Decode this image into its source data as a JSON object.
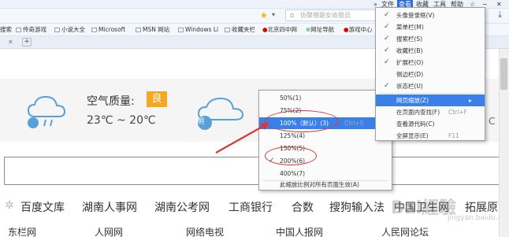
{
  "menubar": {
    "items": [
      "»",
      "文件",
      "查看",
      "收藏",
      "工具",
      "帮助"
    ],
    "active": "查看"
  },
  "addressbar": {
    "search_placeholder": "协警猥褻女收银员"
  },
  "favorites": [
    "搜索",
    "传奇游戏",
    "小说大全",
    "Microsoft",
    "MSN 网站",
    "Windows Li",
    "收藏夹栏",
    "北京四中网",
    "网址导航",
    "游戏中心"
  ],
  "weather": {
    "air_quality_label": "空气质量:",
    "air_quality_value": "良",
    "temperature": "23℃ ~ 20℃",
    "day2_label": "明",
    "day2_temp_partial": "C"
  },
  "links": [
    "百度文库",
    "湖南人事网",
    "湖南公考网",
    "工商银行",
    "合数",
    "搜狗输入法",
    "中国卫生网",
    "拓展原"
  ],
  "bottom_links": [
    "东栏网",
    "人网网",
    "网络电视",
    "中国人报网",
    "人民网论坛"
  ],
  "zoom_menu": {
    "items": [
      {
        "label": "50%(1)",
        "shortcut": "",
        "checked": false,
        "selected": false
      },
      {
        "label": "75%(2)",
        "shortcut": "",
        "checked": false,
        "selected": false
      },
      {
        "label": "100%（默认）(3)",
        "shortcut": "Ctrl+0",
        "checked": false,
        "selected": true
      },
      {
        "label": "125%(4)",
        "shortcut": "",
        "checked": false,
        "selected": false
      },
      {
        "label": "150%(5)",
        "shortcut": "",
        "checked": false,
        "selected": false
      },
      {
        "label": "200%(6)",
        "shortcut": "",
        "checked": true,
        "selected": false
      },
      {
        "label": "400%(7)",
        "shortcut": "",
        "checked": false,
        "selected": false
      }
    ],
    "footer": "此缩放比例对所有页面生效(A)"
  },
  "view_menu": {
    "items": [
      {
        "label": "头像登录框(V)",
        "checked": true
      },
      {
        "label": "菜单栏(M)",
        "checked": true
      },
      {
        "label": "搜索栏(S)",
        "checked": true
      },
      {
        "label": "收藏栏(B)",
        "checked": true
      },
      {
        "label": "扩展栏(O)",
        "checked": true
      },
      {
        "label": "侧边栏(D)",
        "checked": false
      },
      {
        "label": "状态栏(U)",
        "checked": true
      }
    ],
    "zoom_item": "网页缩放(Z)",
    "find_item": "在页面内查找(F)",
    "find_shortcut": "Ctrl+F",
    "source_item": "查看源代码(C)",
    "fullscreen_item": "全屏显示(E)",
    "fullscreen_shortcut": "F11"
  },
  "watermark": {
    "text": "Bai經驗",
    "sub": "jingyan.baidu.com"
  },
  "colors": {
    "menu_highlight": "#3b80e8",
    "annotation": "#d9383a",
    "badge": "#f5a623"
  }
}
